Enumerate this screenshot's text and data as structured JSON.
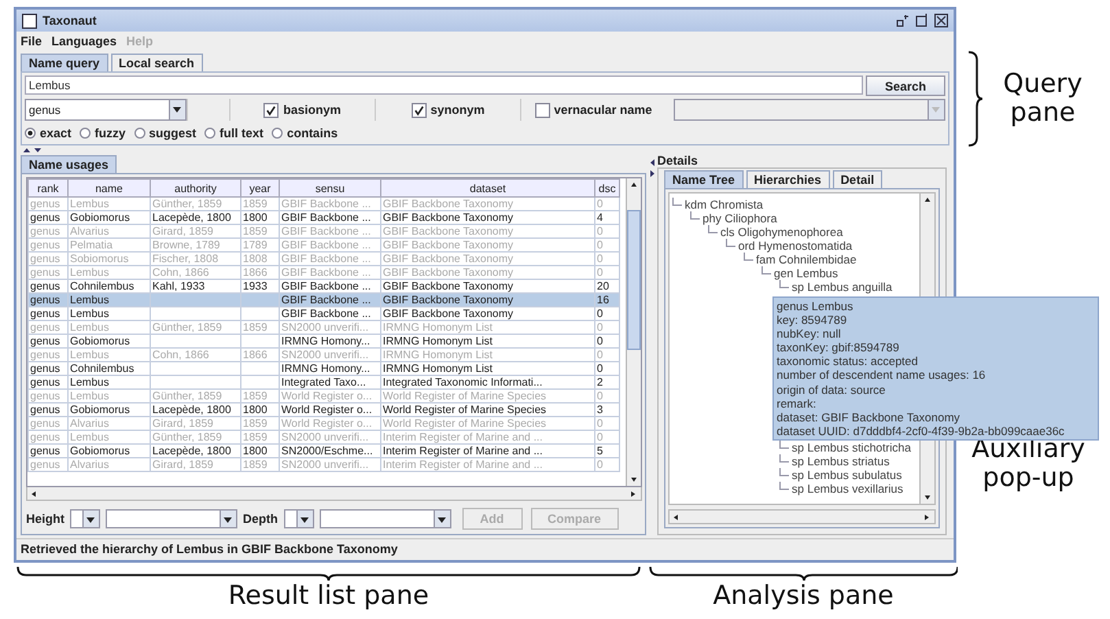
{
  "window": {
    "title": "Taxonaut"
  },
  "menu": [
    {
      "label": "File",
      "disabled": false
    },
    {
      "label": "Languages",
      "disabled": false
    },
    {
      "label": "Help",
      "disabled": true
    }
  ],
  "query_tabs": [
    {
      "label": "Name query",
      "selected": true
    },
    {
      "label": "Local search",
      "selected": false
    }
  ],
  "search": {
    "value": "Lembus",
    "button": "Search"
  },
  "rank_select": {
    "value": "genus"
  },
  "checkboxes": [
    {
      "label": "basionym",
      "checked": true
    },
    {
      "label": "synonym",
      "checked": true
    },
    {
      "label": "vernacular name",
      "checked": false
    }
  ],
  "match_modes": [
    {
      "label": "exact",
      "selected": true
    },
    {
      "label": "fuzzy",
      "selected": false
    },
    {
      "label": "suggest",
      "selected": false
    },
    {
      "label": "full text",
      "selected": false
    },
    {
      "label": "contains",
      "selected": false
    }
  ],
  "results": {
    "tab": "Name usages",
    "columns": [
      "rank",
      "name",
      "authority",
      "year",
      "sensu",
      "dataset",
      "dsc"
    ],
    "rows": [
      {
        "cells": [
          "genus",
          "Lembus",
          "Günther, 1859",
          "1859",
          "GBIF Backbone ...",
          "GBIF Backbone Taxonomy",
          "0"
        ],
        "greyed": true,
        "selected": false
      },
      {
        "cells": [
          "genus",
          "Gobiomorus",
          "Lacepède, 1800",
          "1800",
          "GBIF Backbone ...",
          "GBIF Backbone Taxonomy",
          "4"
        ],
        "greyed": false,
        "selected": false
      },
      {
        "cells": [
          "genus",
          "Alvarius",
          "Girard, 1859",
          "1859",
          "GBIF Backbone ...",
          "GBIF Backbone Taxonomy",
          "0"
        ],
        "greyed": true,
        "selected": false
      },
      {
        "cells": [
          "genus",
          "Pelmatia",
          "Browne, 1789",
          "1789",
          "GBIF Backbone ...",
          "GBIF Backbone Taxonomy",
          "0"
        ],
        "greyed": true,
        "selected": false
      },
      {
        "cells": [
          "genus",
          "Sobiomorus",
          "Fischer, 1808",
          "1808",
          "GBIF Backbone ...",
          "GBIF Backbone Taxonomy",
          "0"
        ],
        "greyed": true,
        "selected": false
      },
      {
        "cells": [
          "genus",
          "Lembus",
          "Cohn, 1866",
          "1866",
          "GBIF Backbone ...",
          "GBIF Backbone Taxonomy",
          "0"
        ],
        "greyed": true,
        "selected": false
      },
      {
        "cells": [
          "genus",
          "Cohnilembus",
          "Kahl, 1933",
          "1933",
          "GBIF Backbone ...",
          "GBIF Backbone Taxonomy",
          "20"
        ],
        "greyed": false,
        "selected": false
      },
      {
        "cells": [
          "genus",
          "Lembus",
          "",
          "",
          "GBIF Backbone ...",
          "GBIF Backbone Taxonomy",
          "16"
        ],
        "greyed": false,
        "selected": true
      },
      {
        "cells": [
          "genus",
          "Lembus",
          "",
          "",
          "GBIF Backbone ...",
          "GBIF Backbone Taxonomy",
          "0"
        ],
        "greyed": false,
        "selected": false
      },
      {
        "cells": [
          "genus",
          "Lembus",
          "Günther, 1859",
          "1859",
          "SN2000 unverifi...",
          "IRMNG Homonym List",
          "0"
        ],
        "greyed": true,
        "selected": false
      },
      {
        "cells": [
          "genus",
          "Gobiomorus",
          "",
          "",
          "IRMNG Homony...",
          "IRMNG Homonym List",
          "0"
        ],
        "greyed": false,
        "selected": false
      },
      {
        "cells": [
          "genus",
          "Lembus",
          "Cohn, 1866",
          "1866",
          "SN2000 unverifi...",
          "IRMNG Homonym List",
          "0"
        ],
        "greyed": true,
        "selected": false
      },
      {
        "cells": [
          "genus",
          "Cohnilembus",
          "",
          "",
          "IRMNG Homony...",
          "IRMNG Homonym List",
          "0"
        ],
        "greyed": false,
        "selected": false
      },
      {
        "cells": [
          "genus",
          "Lembus",
          "",
          "",
          "Integrated Taxo...",
          "Integrated Taxonomic Informati...",
          "2"
        ],
        "greyed": false,
        "selected": false
      },
      {
        "cells": [
          "genus",
          "Lembus",
          "Günther, 1859",
          "1859",
          "World Register o...",
          "World Register of Marine Species",
          "0"
        ],
        "greyed": true,
        "selected": false
      },
      {
        "cells": [
          "genus",
          "Gobiomorus",
          "Lacepède, 1800",
          "1800",
          "World Register o...",
          "World Register of Marine Species",
          "3"
        ],
        "greyed": false,
        "selected": false
      },
      {
        "cells": [
          "genus",
          "Alvarius",
          "Girard, 1859",
          "1859",
          "World Register o...",
          "World Register of Marine Species",
          "0"
        ],
        "greyed": true,
        "selected": false
      },
      {
        "cells": [
          "genus",
          "Lembus",
          "Günther, 1859",
          "1859",
          "SN2000 unverifi...",
          "Interim Register of Marine and ...",
          "0"
        ],
        "greyed": true,
        "selected": false
      },
      {
        "cells": [
          "genus",
          "Gobiomorus",
          "Lacepède, 1800",
          "1800",
          "SN2000/Eschme...",
          "Interim Register of Marine and ...",
          "5"
        ],
        "greyed": false,
        "selected": false
      },
      {
        "cells": [
          "genus",
          "Alvarius",
          "Girard, 1859",
          "1859",
          "SN2000 unverifi...",
          "Interim Register of Marine and ...",
          "0"
        ],
        "greyed": true,
        "selected": false
      }
    ],
    "height_label": "Height",
    "depth_label": "Depth",
    "buttons": [
      {
        "label": "Add",
        "disabled": true
      },
      {
        "label": "Compare",
        "disabled": true
      }
    ]
  },
  "details": {
    "title": "Details",
    "tabs": [
      {
        "label": "Name Tree",
        "selected": true
      },
      {
        "label": "Hierarchies",
        "selected": false
      },
      {
        "label": "Detail",
        "selected": false
      }
    ],
    "tree": [
      {
        "label": "kdm Chromista",
        "children": [
          {
            "label": "phy Ciliophora",
            "children": [
              {
                "label": "cls Oligohymenophorea",
                "children": [
                  {
                    "label": "ord Hymenostomatida",
                    "children": [
                      {
                        "label": "fam Cohnilembidae",
                        "children": [
                          {
                            "label": "gen Lembus",
                            "children": [
                              {
                                "label": "sp Lembus anguilla"
                              },
                              {
                                "label": "sp Lembus stichotricha"
                              },
                              {
                                "label": "sp Lembus striatus"
                              },
                              {
                                "label": "sp Lembus subulatus"
                              },
                              {
                                "label": "sp Lembus vexillarius"
                              }
                            ]
                          }
                        ]
                      }
                    ]
                  }
                ]
              }
            ]
          }
        ]
      }
    ],
    "tooltip": [
      "genus Lembus",
      "key: 8594789",
      "nubKey: null",
      "taxonKey: gbif:8594789",
      "taxonomic status: accepted",
      "number of descendent name usages: 16",
      "origin of data: source",
      "remark:",
      "dataset: GBIF Backbone Taxonomy",
      "dataset UUID: d7dddbf4-2cf0-4f39-9b2a-bb099caae36c"
    ]
  },
  "status_bar": "Retrieved the hierarchy of Lembus  in GBIF Backbone Taxonomy",
  "annotations": {
    "query": "Query pane",
    "auxiliary": "Auxiliary pop-up",
    "result": "Result list pane",
    "analysis": "Analysis pane"
  }
}
